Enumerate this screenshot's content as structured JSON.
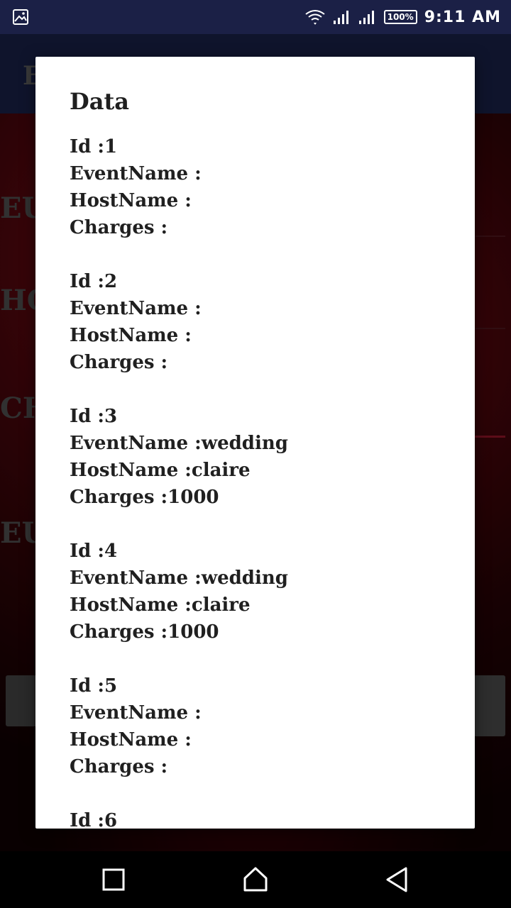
{
  "status_bar": {
    "time": "9:11 AM",
    "battery": "100%",
    "icons": [
      "image-icon",
      "wifi-icon",
      "signal-icon",
      "signal-icon",
      "battery-icon"
    ]
  },
  "app_bar": {
    "title": "E"
  },
  "background": {
    "labels": [
      "EU",
      "HO",
      "CH",
      "EU"
    ]
  },
  "dialog": {
    "title": "Data",
    "records": [
      {
        "id": "Id :1",
        "event": "EventName :",
        "host": "HostName :",
        "charges": "Charges :"
      },
      {
        "id": "Id :2",
        "event": "EventName :",
        "host": "HostName :",
        "charges": "Charges :"
      },
      {
        "id": "Id :3",
        "event": "EventName :wedding",
        "host": "HostName :claire",
        "charges": "Charges :1000"
      },
      {
        "id": "Id :4",
        "event": "EventName :wedding",
        "host": "HostName :claire",
        "charges": "Charges :1000"
      },
      {
        "id": "Id :5",
        "event": "EventName :",
        "host": "HostName :",
        "charges": "Charges :"
      },
      {
        "id": "Id :6",
        "event": "",
        "host": "",
        "charges": ""
      }
    ]
  },
  "nav_bar": {
    "buttons": [
      "recents-icon",
      "home-icon",
      "back-icon"
    ]
  }
}
